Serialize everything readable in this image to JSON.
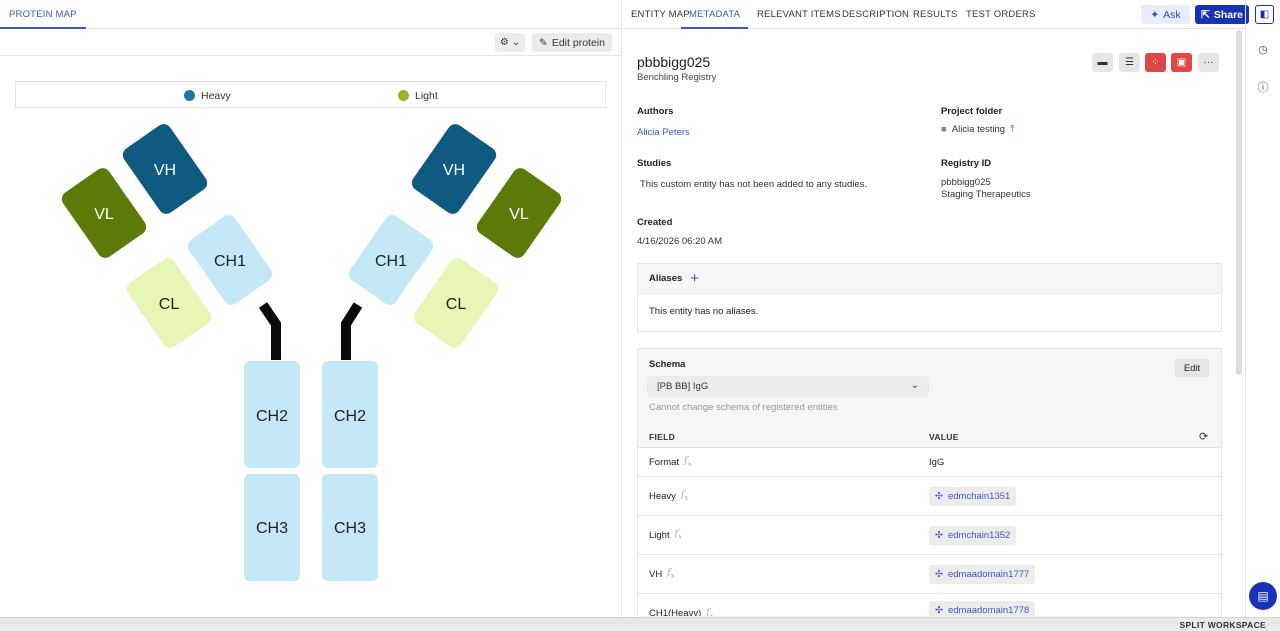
{
  "left": {
    "tab_label": "PROTEIN MAP",
    "edit_protein_label": "Edit protein",
    "legend": [
      {
        "label": "Heavy",
        "color": "#1e7aa3"
      },
      {
        "label": "Light",
        "color": "#8fb82a"
      }
    ],
    "domains": {
      "vh": "VH",
      "vl": "VL",
      "ch1": "CH1",
      "cl": "CL",
      "ch2": "CH2",
      "ch3": "CH3"
    },
    "colors": {
      "vh": "#0f5a80",
      "vl": "#5c7a08",
      "ch": "#c5e8f7",
      "cl": "#e5f6b5",
      "hinge": "#0a0a0a"
    }
  },
  "right": {
    "tabs": [
      {
        "label": "ENTITY MAP",
        "active": false
      },
      {
        "label": "METADATA",
        "active": true
      },
      {
        "label": "RELEVANT ITEMS",
        "active": false
      },
      {
        "label": "DESCRIPTION",
        "active": false
      },
      {
        "label": "RESULTS",
        "active": false
      },
      {
        "label": "TEST ORDERS",
        "active": false
      }
    ],
    "ask_label": "Ask",
    "share_label": "Share",
    "entity": {
      "name": "pbbbigg025",
      "registry": "Benchling Registry"
    },
    "metadata": {
      "authors_label": "Authors",
      "authors_value": "Alicia Peters",
      "project_folder_label": "Project folder",
      "project_folder_value": "Alicia testing",
      "studies_label": "Studies",
      "studies_value": "This custom entity has not been added to any studies.",
      "registry_id_label": "Registry ID",
      "registry_id_value": "pbbbigg025",
      "registry_id_org": "Staging Therapeutics",
      "created_label": "Created",
      "created_value": "4/16/2026 06:20 AM"
    },
    "aliases": {
      "label": "Aliases",
      "empty_text": "This entity has no aliases."
    },
    "schema": {
      "label": "Schema",
      "edit_label": "Edit",
      "selected": "[PB BB] IgG",
      "note": "Cannot change schema of registered entities",
      "field_header": "FIELD",
      "value_header": "VALUE",
      "rows": [
        {
          "field": "Format",
          "value": "IgG",
          "is_link": false
        },
        {
          "field": "Heavy",
          "value": "edmchain1351",
          "is_link": true
        },
        {
          "field": "Light",
          "value": "edmchain1352",
          "is_link": true
        },
        {
          "field": "VH",
          "value": "edmaadomain1777",
          "is_link": true
        },
        {
          "field": "CH1(Heavy)",
          "value": "edmaadomain1778",
          "is_link": true
        }
      ]
    }
  },
  "bottom": {
    "split_workspace_label": "SPLIT WORKSPACE"
  }
}
